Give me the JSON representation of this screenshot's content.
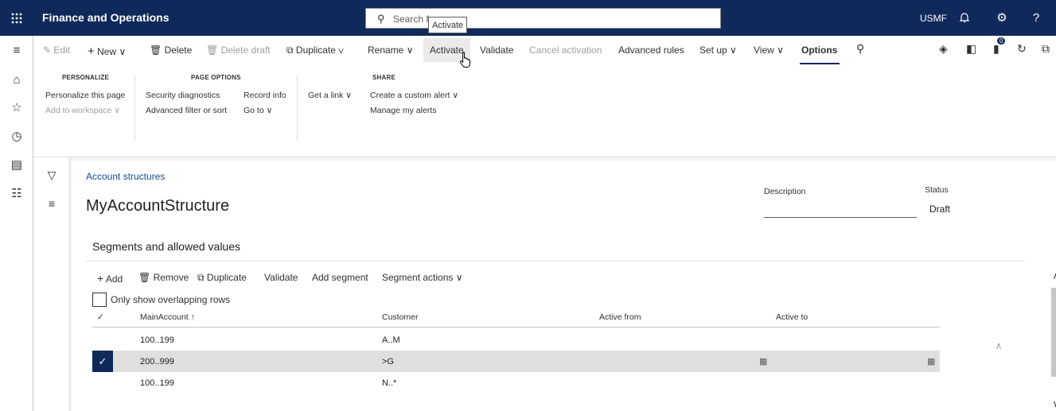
{
  "topbar": {
    "app_title": "Finance and Operations",
    "search_placeholder": "Search f",
    "tooltip": "Activate",
    "company": "USMF",
    "icons": [
      "waffle-icon",
      "bell-icon",
      "gear-icon",
      "help-icon"
    ],
    "help_glyph": "?"
  },
  "navrail": {
    "icons": [
      "hamburger-icon",
      "home-icon",
      "star-icon",
      "recent-icon",
      "workspaces-icon",
      "modules-icon"
    ]
  },
  "actionpane": {
    "edit": "Edit",
    "new": "New",
    "delete": "Delete",
    "delete_draft": "Delete draft",
    "duplicate": "Duplicate",
    "rename": "Rename",
    "activate": "Activate",
    "validate": "Validate",
    "cancel_activation": "Cancel activation",
    "advanced_rules": "Advanced rules",
    "set_up": "Set up",
    "view": "View",
    "options": "Options",
    "attachments_count": "0"
  },
  "ribbon": {
    "personalize_title": "PERSONALIZE",
    "personalize_this_page": "Personalize this page",
    "add_to_workspace": "Add to workspace",
    "page_options_title": "PAGE OPTIONS",
    "security_diagnostics": "Security diagnostics",
    "record_info": "Record info",
    "advanced_filter": "Advanced filter or sort",
    "go_to": "Go to",
    "get_a_link": "Get a link",
    "share_title": "SHARE",
    "create_alert": "Create a custom alert",
    "manage_alerts": "Manage my alerts"
  },
  "header": {
    "breadcrumb": "Account structures",
    "title": "MyAccountStructure",
    "description_label": "Description",
    "description_value": "",
    "status_label": "Status",
    "status_value": "Draft"
  },
  "section": {
    "title": "Segments and allowed values",
    "actions": {
      "add": "Add",
      "remove": "Remove",
      "duplicate": "Duplicate",
      "validate": "Validate",
      "add_segment": "Add segment",
      "segment_actions": "Segment actions"
    },
    "overlap_label": "Only show overlapping rows",
    "columns": {
      "main_account": "MainAccount",
      "customer": "Customer",
      "active_from": "Active from",
      "active_to": "Active to"
    },
    "rows": [
      {
        "main_account": "100..199",
        "customer": "A..M"
      },
      {
        "main_account": "200..999",
        "customer": ">G"
      },
      {
        "main_account": "100..199",
        "customer": "N..*"
      }
    ]
  }
}
